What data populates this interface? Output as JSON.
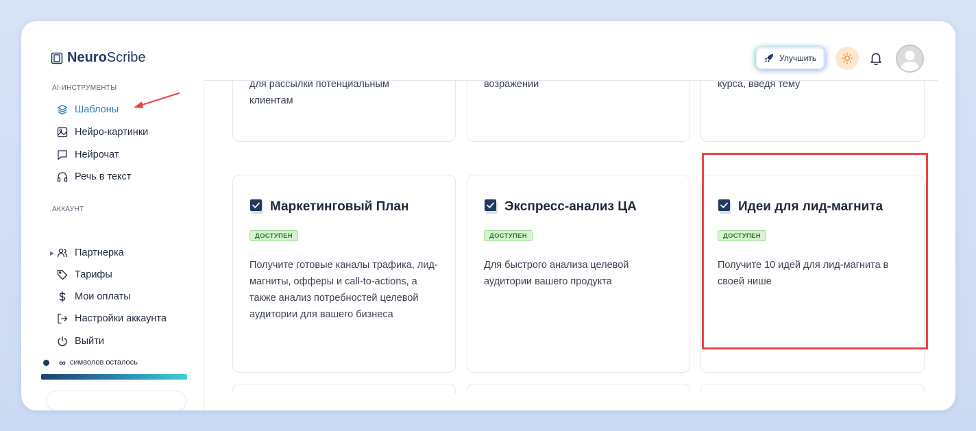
{
  "app": {
    "logo_bold": "Neuro",
    "logo_regular": "Scribe"
  },
  "header": {
    "upgrade_label": "Улучшить",
    "accent_color": "#1f3a63"
  },
  "sidebar": {
    "ai_section_title": "AI-ИНСТРУМЕНТЫ",
    "ai_items": [
      {
        "label": "Шаблоны",
        "icon": "layers-icon",
        "active": true
      },
      {
        "label": "Нейро-картинки",
        "icon": "image-icon"
      },
      {
        "label": "Нейрочат",
        "icon": "chat-icon"
      },
      {
        "label": "Речь в текст",
        "icon": "headphones-icon"
      }
    ],
    "account_section_title": "АККАУНТ",
    "account_items": [
      {
        "label": "Партнерка",
        "icon": "users-icon"
      },
      {
        "label": "Тарифы",
        "icon": "tag-icon"
      },
      {
        "label": "Мои оплаты",
        "icon": "dollar-icon"
      },
      {
        "label": "Настройки аккаунта",
        "icon": "login-icon"
      },
      {
        "label": "Выйти",
        "icon": "power-icon"
      }
    ],
    "credits_symbol": "∞",
    "credits_label": "символов осталось",
    "credits_progress": 1.0
  },
  "cards": {
    "top_row": [
      {
        "desc": "для рассылки потенциальным клиентам"
      },
      {
        "desc": "возражении"
      },
      {
        "desc": "курса, введя тему"
      }
    ],
    "middle_row": [
      {
        "title": "Маркетинговый План",
        "badge": "ДОСТУПЕН",
        "desc": "Получите готовые каналы трафика, лид-магниты, офферы и call-to-actions, а также анализ потребностей целевой аудитории для вашего бизнеса"
      },
      {
        "title": "Экспресс-анализ ЦА",
        "badge": "ДОСТУПЕН",
        "desc": "Для быстрого анализа целевой аудитории вашего продукта"
      },
      {
        "title": "Идеи для лид-магнита",
        "badge": "ДОСТУПЕН",
        "desc": "Получите 10 идей для лид-магнита в своей нише",
        "highlighted": true
      }
    ]
  }
}
